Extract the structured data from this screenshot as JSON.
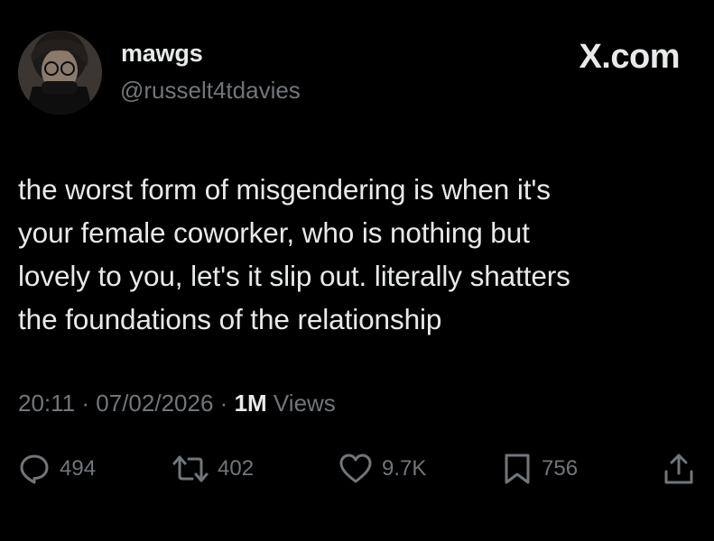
{
  "author": {
    "display_name": "mawgs",
    "handle": "@russelt4tdavies",
    "avatar": "profile-photo"
  },
  "brand": {
    "label": "X.com"
  },
  "tweet": {
    "text": "the worst form of misgendering is when it's\nyour female coworker, who is nothing but\nlovely to you, let's it slip out. literally shatters\nthe foundations of the relationship"
  },
  "meta": {
    "time": "20:11",
    "separator": "·",
    "date": "07/02/2026",
    "views_count": "1M",
    "views_label": "Views"
  },
  "actions": {
    "replies": {
      "icon": "reply-icon",
      "count": "494"
    },
    "reposts": {
      "icon": "repost-icon",
      "count": "402"
    },
    "likes": {
      "icon": "heart-icon",
      "count": "9.7K"
    },
    "bookmarks": {
      "icon": "bookmark-icon",
      "count": "756"
    },
    "share": {
      "icon": "share-icon"
    }
  },
  "colors": {
    "background": "#000000",
    "text_primary": "#e7e9ea",
    "text_secondary": "#71767b"
  }
}
